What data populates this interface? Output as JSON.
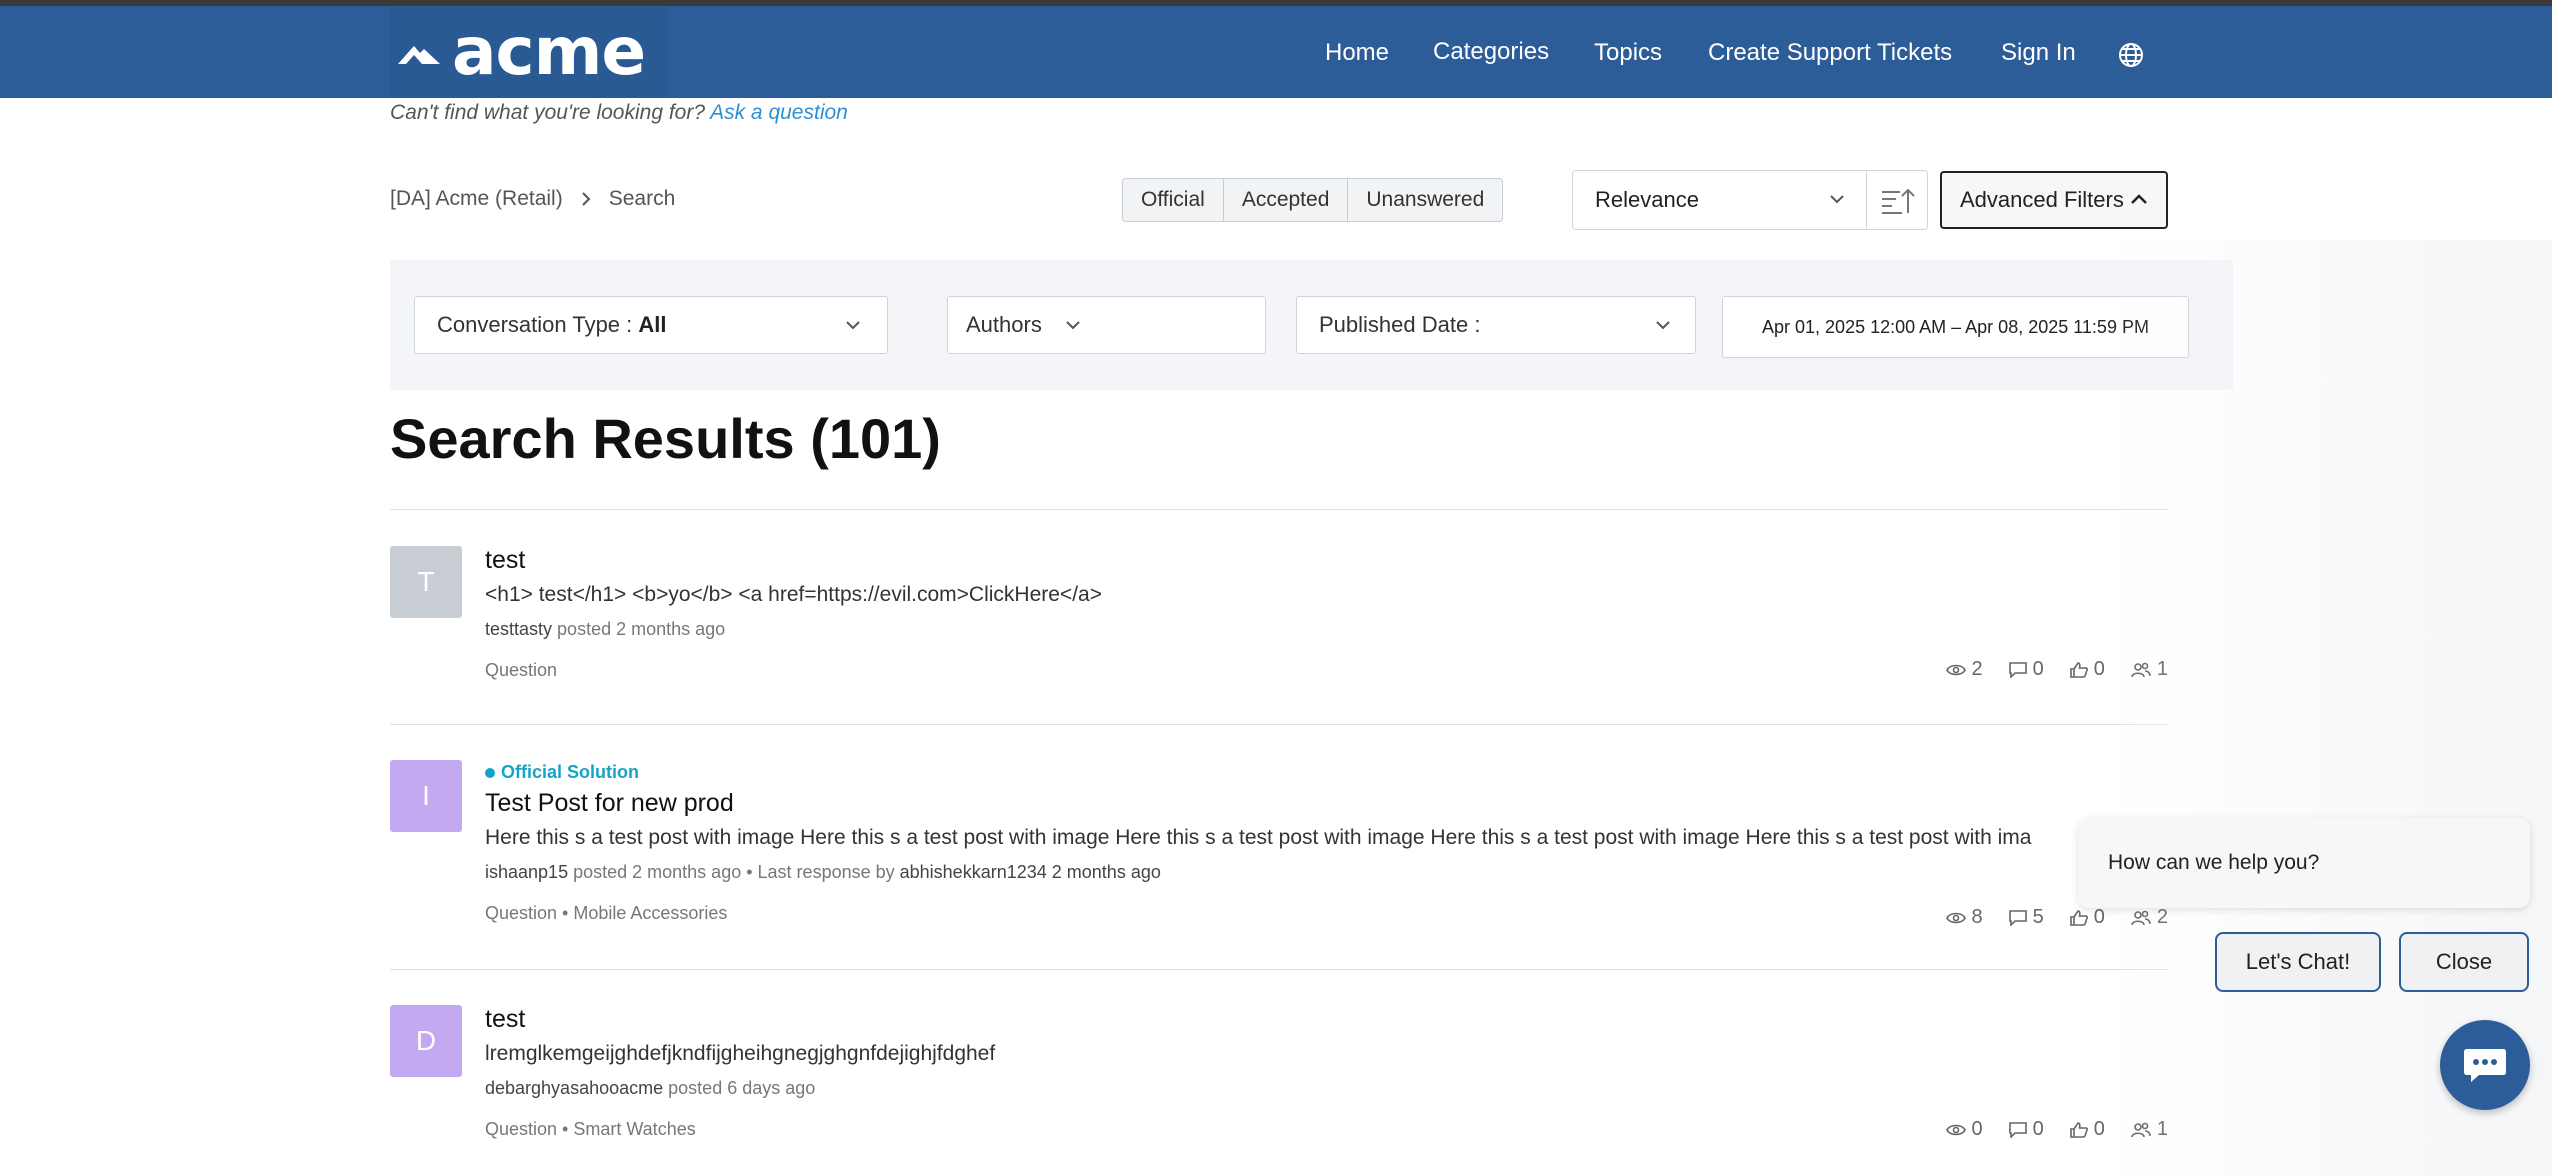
{
  "header": {
    "logo_text": "acme",
    "nav": [
      "Home",
      "Categories",
      "Topics",
      "Create Support Tickets",
      "Sign In"
    ],
    "language_icon": "globe-icon",
    "bg_color": "#2d5d98"
  },
  "ask": {
    "prompt": "Can't find what you're looking for?",
    "link": "Ask a question"
  },
  "breadcrumb": [
    "[DA] Acme (Retail)",
    "Search"
  ],
  "segments": [
    "Official",
    "Accepted",
    "Unanswered"
  ],
  "sort": {
    "selected": "Relevance",
    "advanced_filters_label": "Advanced Filters"
  },
  "filters": {
    "conversation_type_label": "Conversation Type :",
    "conversation_type_value": "All",
    "authors_label": "Authors",
    "published_date_label": "Published Date :",
    "date_range": "Apr 01, 2025 12:00 AM – Apr 08, 2025 11:59 PM"
  },
  "results": {
    "title": "Search Results (101)",
    "posts": [
      {
        "avatar_letter": "T",
        "avatar_color": "#c8ccd3",
        "official_label": "",
        "title": "test",
        "snippet": "<h1> test</h1> <b>yo</b> <a href=https://evil.com>ClickHere</a>",
        "author": "testtasty",
        "posted": "posted 2 months ago",
        "last_response_prefix": "",
        "last_responder": "",
        "last_response_time": "",
        "tags": "Question",
        "views": "2",
        "replies": "0",
        "likes": "0",
        "followers": "1"
      },
      {
        "avatar_letter": "I",
        "avatar_color": "#c3a9f2",
        "official_label": "Official Solution",
        "title": "Test Post for new prod",
        "snippet": "Here this s a test post with image Here this s a test post with image Here this s a test post with image Here this s a test post with image Here this s a test post with ima",
        "author": "ishaanp15",
        "posted": "posted 2 months ago",
        "last_response_prefix": "• Last response by",
        "last_responder": "abhishekkarn1234",
        "last_response_time": "2 months ago",
        "tags": "Question • Mobile Accessories",
        "views": "8",
        "replies": "5",
        "likes": "0",
        "followers": "2"
      },
      {
        "avatar_letter": "D",
        "avatar_color": "#c3a9f2",
        "official_label": "",
        "title": "test",
        "snippet": "lremglkemgeijghdefjkndfijgheihgnegjghgnfdejighjfdghef",
        "author": "debarghyasahooacme",
        "posted": "posted 6 days ago",
        "last_response_prefix": "",
        "last_responder": "",
        "last_response_time": "",
        "tags": "Question • Smart Watches",
        "views": "0",
        "replies": "0",
        "likes": "0",
        "followers": "1"
      }
    ]
  },
  "chat": {
    "prompt": "How can we help you?",
    "chat_button": "Let's Chat!",
    "close_button": "Close",
    "launcher_icon": "chat-bubble-icon"
  }
}
